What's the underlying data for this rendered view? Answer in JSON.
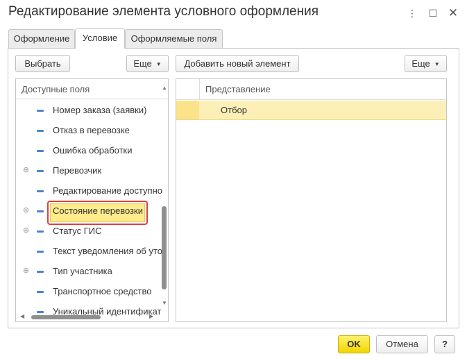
{
  "window": {
    "title": "Редактирование элемента условного оформления",
    "minimize_glyph": "⋮",
    "maximize_glyph": "☐",
    "close_glyph": "✕"
  },
  "tabs": [
    {
      "label": "Оформление",
      "active": false
    },
    {
      "label": "Условие",
      "active": true
    },
    {
      "label": "Оформляемые поля",
      "active": false
    }
  ],
  "left": {
    "select_button": "Выбрать",
    "more_button": "Еще",
    "header": "Доступные поля",
    "items": [
      {
        "label": "Номер заказа (заявки)",
        "expandable": false
      },
      {
        "label": "Отказ в перевозке",
        "expandable": false
      },
      {
        "label": "Ошибка обработки",
        "expandable": false
      },
      {
        "label": "Перевозчик",
        "expandable": true
      },
      {
        "label": "Редактирование доступно",
        "expandable": false
      },
      {
        "label": "Состояние перевозки",
        "expandable": true,
        "selected": true
      },
      {
        "label": "Статус ГИС",
        "expandable": true
      },
      {
        "label": "Текст уведомления об уто",
        "expandable": false
      },
      {
        "label": "Тип участника",
        "expandable": true
      },
      {
        "label": "Транспортное средство",
        "expandable": false
      },
      {
        "label": "Уникальный идентификат",
        "expandable": false
      }
    ]
  },
  "right": {
    "add_button": "Добавить новый элемент",
    "more_button": "Еще",
    "column_header": "Представление",
    "rows": [
      {
        "label": "Отбор"
      }
    ]
  },
  "footer": {
    "ok": "OK",
    "cancel": "Отмена",
    "help": "?"
  },
  "colors": {
    "accent_yellow": "#f1d500",
    "selection_yellow": "#fdeb8c",
    "highlight_red": "#d9413c",
    "tree_dash_blue": "#4a86c7"
  }
}
